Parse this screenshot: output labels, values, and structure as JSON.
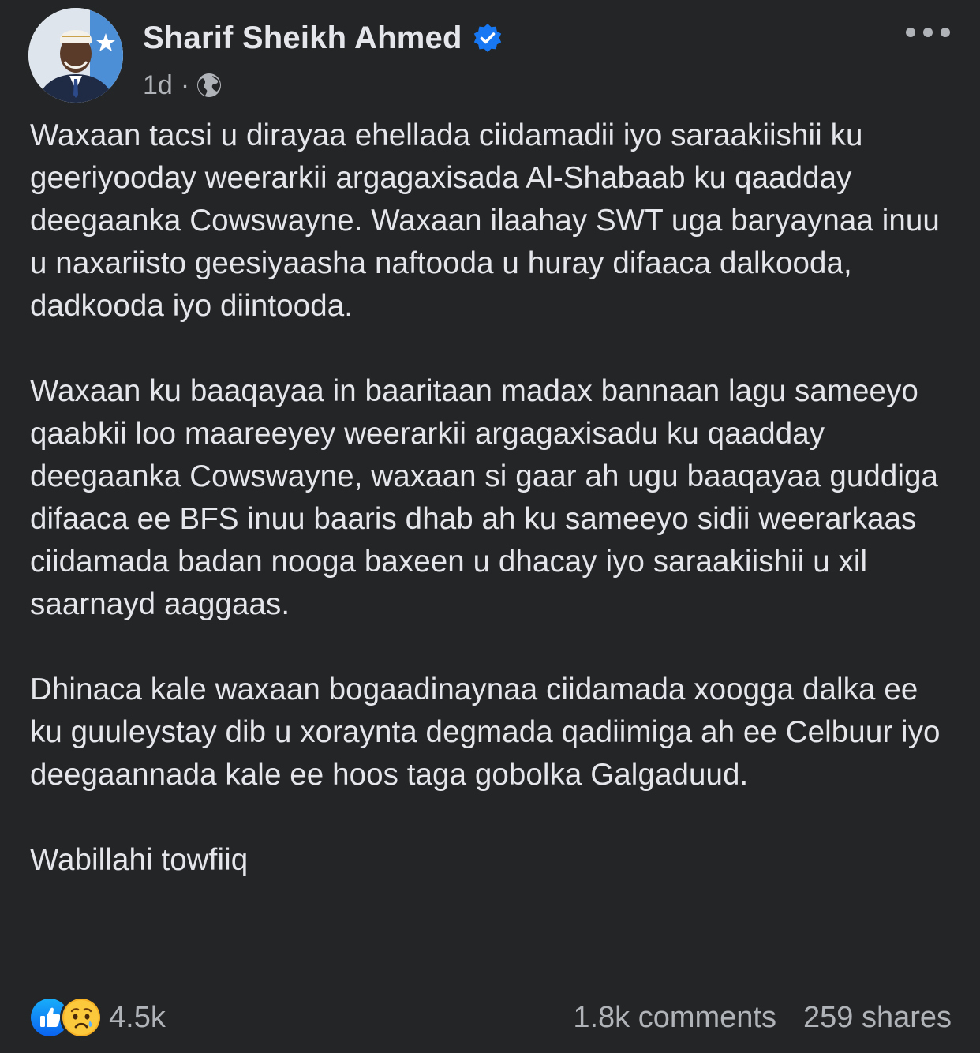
{
  "post": {
    "author": {
      "name": "Sharif Sheikh Ahmed",
      "verified": true
    },
    "meta": {
      "time": "1d",
      "separator": "·",
      "audience_icon": "globe-icon"
    },
    "more_icon": "more-options-icon",
    "paragraphs": [
      "Waxaan tacsi u dirayaa ehellada ciidamadii iyo saraakiishii ku geeriyooday weerarkii argagaxisada Al-Shabaab ku qaadday deegaanka Cowswayne. Waxaan ilaahay SWT uga baryaynaa inuu u naxariisto geesiyaasha naftooda u huray difaaca dalkooda, dadkooda iyo diintooda.",
      "Waxaan ku baaqayaa in baaritaan madax bannaan lagu sameeyo qaabkii loo maareeyey weerarkii argagaxisadu ku qaadday deegaanka Cowswayne, waxaan si gaar ah ugu baaqayaa guddiga difaaca ee BFS inuu baaris dhab ah ku sameeyo sidii weerarkaas ciidamada badan nooga baxeen u dhacay iyo saraakiishii u xil saarnayd aaggaas.",
      "Dhinaca kale waxaan bogaadinaynaa ciidamada xoogga dalka ee ku guuleystay dib u xoraynta degmada qadiimiga ah ee Celbuur iyo deegaannada kale ee hoos taga gobolka Galgaduud.",
      "Wabillahi towfiiq"
    ],
    "footer": {
      "reactions": [
        "like-icon",
        "sad-icon"
      ],
      "reaction_count": "4.5k",
      "comments": "1.8k comments",
      "shares": "259 shares"
    }
  },
  "colors": {
    "background": "#242526",
    "primary_text": "#e4e6eb",
    "secondary_text": "#b0b3b8",
    "accent_blue": "#1877f2",
    "sad_yellow": "#f7b125"
  }
}
